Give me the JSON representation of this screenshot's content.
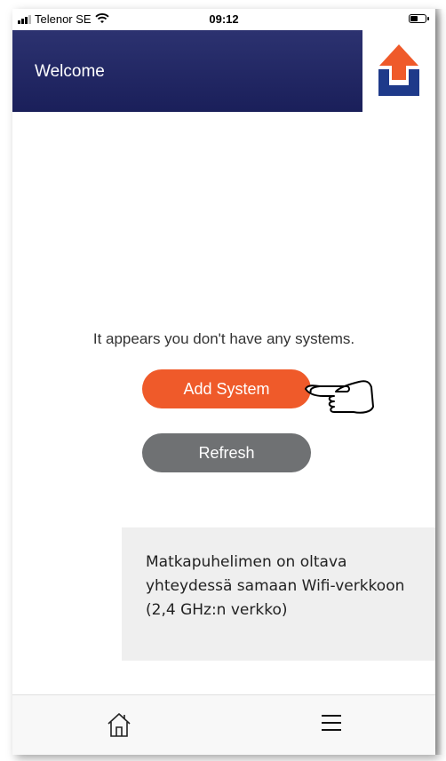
{
  "status_bar": {
    "carrier": "Telenor SE",
    "time": "09:12",
    "icons": [
      "signal-icon",
      "wifi-icon",
      "battery-icon"
    ]
  },
  "header": {
    "title": "Welcome",
    "logo": "upload-arrow-logo"
  },
  "main": {
    "empty_message": "It appears you don't have any systems.",
    "add_button_label": "Add System",
    "refresh_button_label": "Refresh",
    "pointer": "pointing-hand-icon"
  },
  "note": {
    "text": "Matkapuhelimen on oltava yhteydessä samaan Wifi-verkkoon (2,4 GHz:n verkko)"
  },
  "tab_bar": {
    "items": [
      "home-icon",
      "menu-icon"
    ]
  },
  "colors": {
    "header": "#1f2460",
    "accent": "#ef5a2a",
    "refresh": "#6f7173",
    "logo_blue": "#1e3a8a"
  }
}
